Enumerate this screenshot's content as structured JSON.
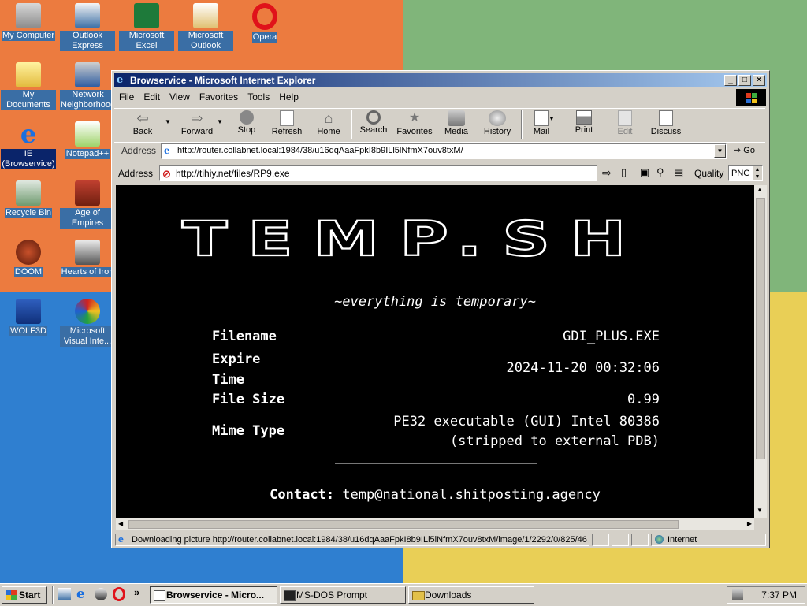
{
  "desktop": {
    "icons": [
      {
        "label": "My Computer",
        "icon": "my-computer-icon"
      },
      {
        "label": "Outlook Express",
        "icon": "outlook-express-icon"
      },
      {
        "label": "Microsoft Excel",
        "icon": "excel-icon"
      },
      {
        "label": "Microsoft Outlook",
        "icon": "outlook-icon"
      },
      {
        "label": "Opera",
        "icon": "opera-icon"
      },
      {
        "label": "My Documents",
        "icon": "my-documents-icon"
      },
      {
        "label": "Network Neighborhood",
        "icon": "network-icon"
      },
      {
        "label": "IE (Browservice)",
        "icon": "ie-icon"
      },
      {
        "label": "Notepad++",
        "icon": "notepad-icon"
      },
      {
        "label": "Recycle Bin",
        "icon": "recycle-bin-icon"
      },
      {
        "label": "Age of Empires",
        "icon": "age-of-empires-icon"
      },
      {
        "label": "DOOM",
        "icon": "doom-icon"
      },
      {
        "label": "Hearts of Iron",
        "icon": "hearts-of-iron-icon"
      },
      {
        "label": "WOLF3D",
        "icon": "wolf3d-icon"
      },
      {
        "label": "Microsoft Visual Inte...",
        "icon": "visual-interdev-icon"
      }
    ]
  },
  "window": {
    "title": "Browservice - Microsoft Internet Explorer",
    "menu": [
      "File",
      "Edit",
      "View",
      "Favorites",
      "Tools",
      "Help"
    ],
    "toolbar": [
      {
        "label": "Back",
        "icon": "back-arrow-icon"
      },
      {
        "label": "Forward",
        "icon": "forward-arrow-icon"
      },
      {
        "label": "Stop",
        "icon": "stop-icon"
      },
      {
        "label": "Refresh",
        "icon": "refresh-icon"
      },
      {
        "label": "Home",
        "icon": "home-icon"
      },
      {
        "label": "Search",
        "icon": "search-icon"
      },
      {
        "label": "Favorites",
        "icon": "favorites-icon"
      },
      {
        "label": "Media",
        "icon": "media-icon"
      },
      {
        "label": "History",
        "icon": "history-icon"
      },
      {
        "label": "Mail",
        "icon": "mail-icon"
      },
      {
        "label": "Print",
        "icon": "print-icon"
      },
      {
        "label": "Edit",
        "icon": "edit-icon"
      },
      {
        "label": "Discuss",
        "icon": "discuss-icon"
      }
    ],
    "address_label": "Address",
    "address_value": "http://router.collabnet.local:1984/38/u16dqAaaFpkI8b9ILl5lNfmX7ouv8txM/",
    "go_label": "Go",
    "status_text": "Downloading picture http://router.collabnet.local:1984/38/u16dqAaaFpkI8b9ILl5lNfmX7ouv8txM/image/1/2292/0/825/46",
    "zone_label": "Internet"
  },
  "browservice": {
    "address_label": "Address",
    "address_value": "http://tihiy.net/files/RP9.exe",
    "quality_label": "Quality",
    "quality_value": "PNG"
  },
  "page": {
    "logo_text": "TEMP.SH",
    "tagline": "~everything is temporary~",
    "rows": [
      {
        "label": "Filename",
        "value": "GDI_PLUS.EXE"
      },
      {
        "label": "Expire Time",
        "value": "2024-11-20 00:32:06"
      },
      {
        "label": "File Size",
        "value": "0.99"
      },
      {
        "label": "Mime Type",
        "value": "PE32 executable (GUI) Intel 80386 (stripped to external PDB)"
      }
    ],
    "contact_label": "Contact:",
    "contact_value": "temp@national.shitposting.agency"
  },
  "taskbar": {
    "start_label": "Start",
    "tasks": [
      "Browservice - Micro...",
      "MS-DOS Prompt",
      "Downloads"
    ],
    "clock": "7:37 PM"
  }
}
